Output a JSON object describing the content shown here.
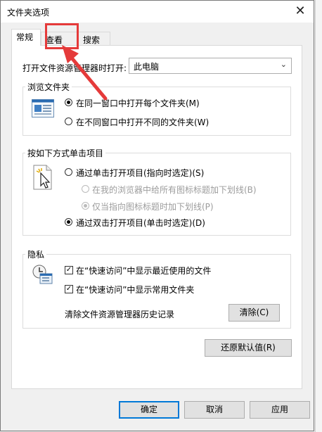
{
  "window": {
    "title": "文件夹选项",
    "close_glyph": "✕"
  },
  "tabs": [
    {
      "label": "常规"
    },
    {
      "label": "查看"
    },
    {
      "label": "搜索"
    }
  ],
  "open_explorer": {
    "label": "打开文件资源管理器时打开:",
    "value": "此电脑"
  },
  "browse": {
    "legend": "浏览文件夹",
    "opt_same": "在同一窗口中打开每个文件夹(M)",
    "opt_new": "在不同窗口中打开不同的文件夹(W)"
  },
  "click": {
    "legend": "按如下方式单击项目",
    "opt_single": "通过单击打开项目(指向时选定)(S)",
    "opt_underline_all": "在我的浏览器中给所有图标标题加下划线(B)",
    "opt_underline_hover": "仅当指向图标标题时加下划线(P)",
    "opt_double": "通过双击打开项目(单击时选定)(D)"
  },
  "privacy": {
    "legend": "隐私",
    "recent_files": "在“快速访问”中显示最近使用的文件",
    "frequent_folders": "在“快速访问”中显示常用文件夹",
    "clear_label": "清除文件资源管理器历史记录",
    "clear_button": "清除(C)"
  },
  "restore_defaults": "还原默认值(R)",
  "footer": {
    "ok": "确定",
    "cancel": "取消",
    "apply": "应用"
  },
  "colors": {
    "accent": "#0078d7",
    "annotation": "#e53a3a"
  }
}
